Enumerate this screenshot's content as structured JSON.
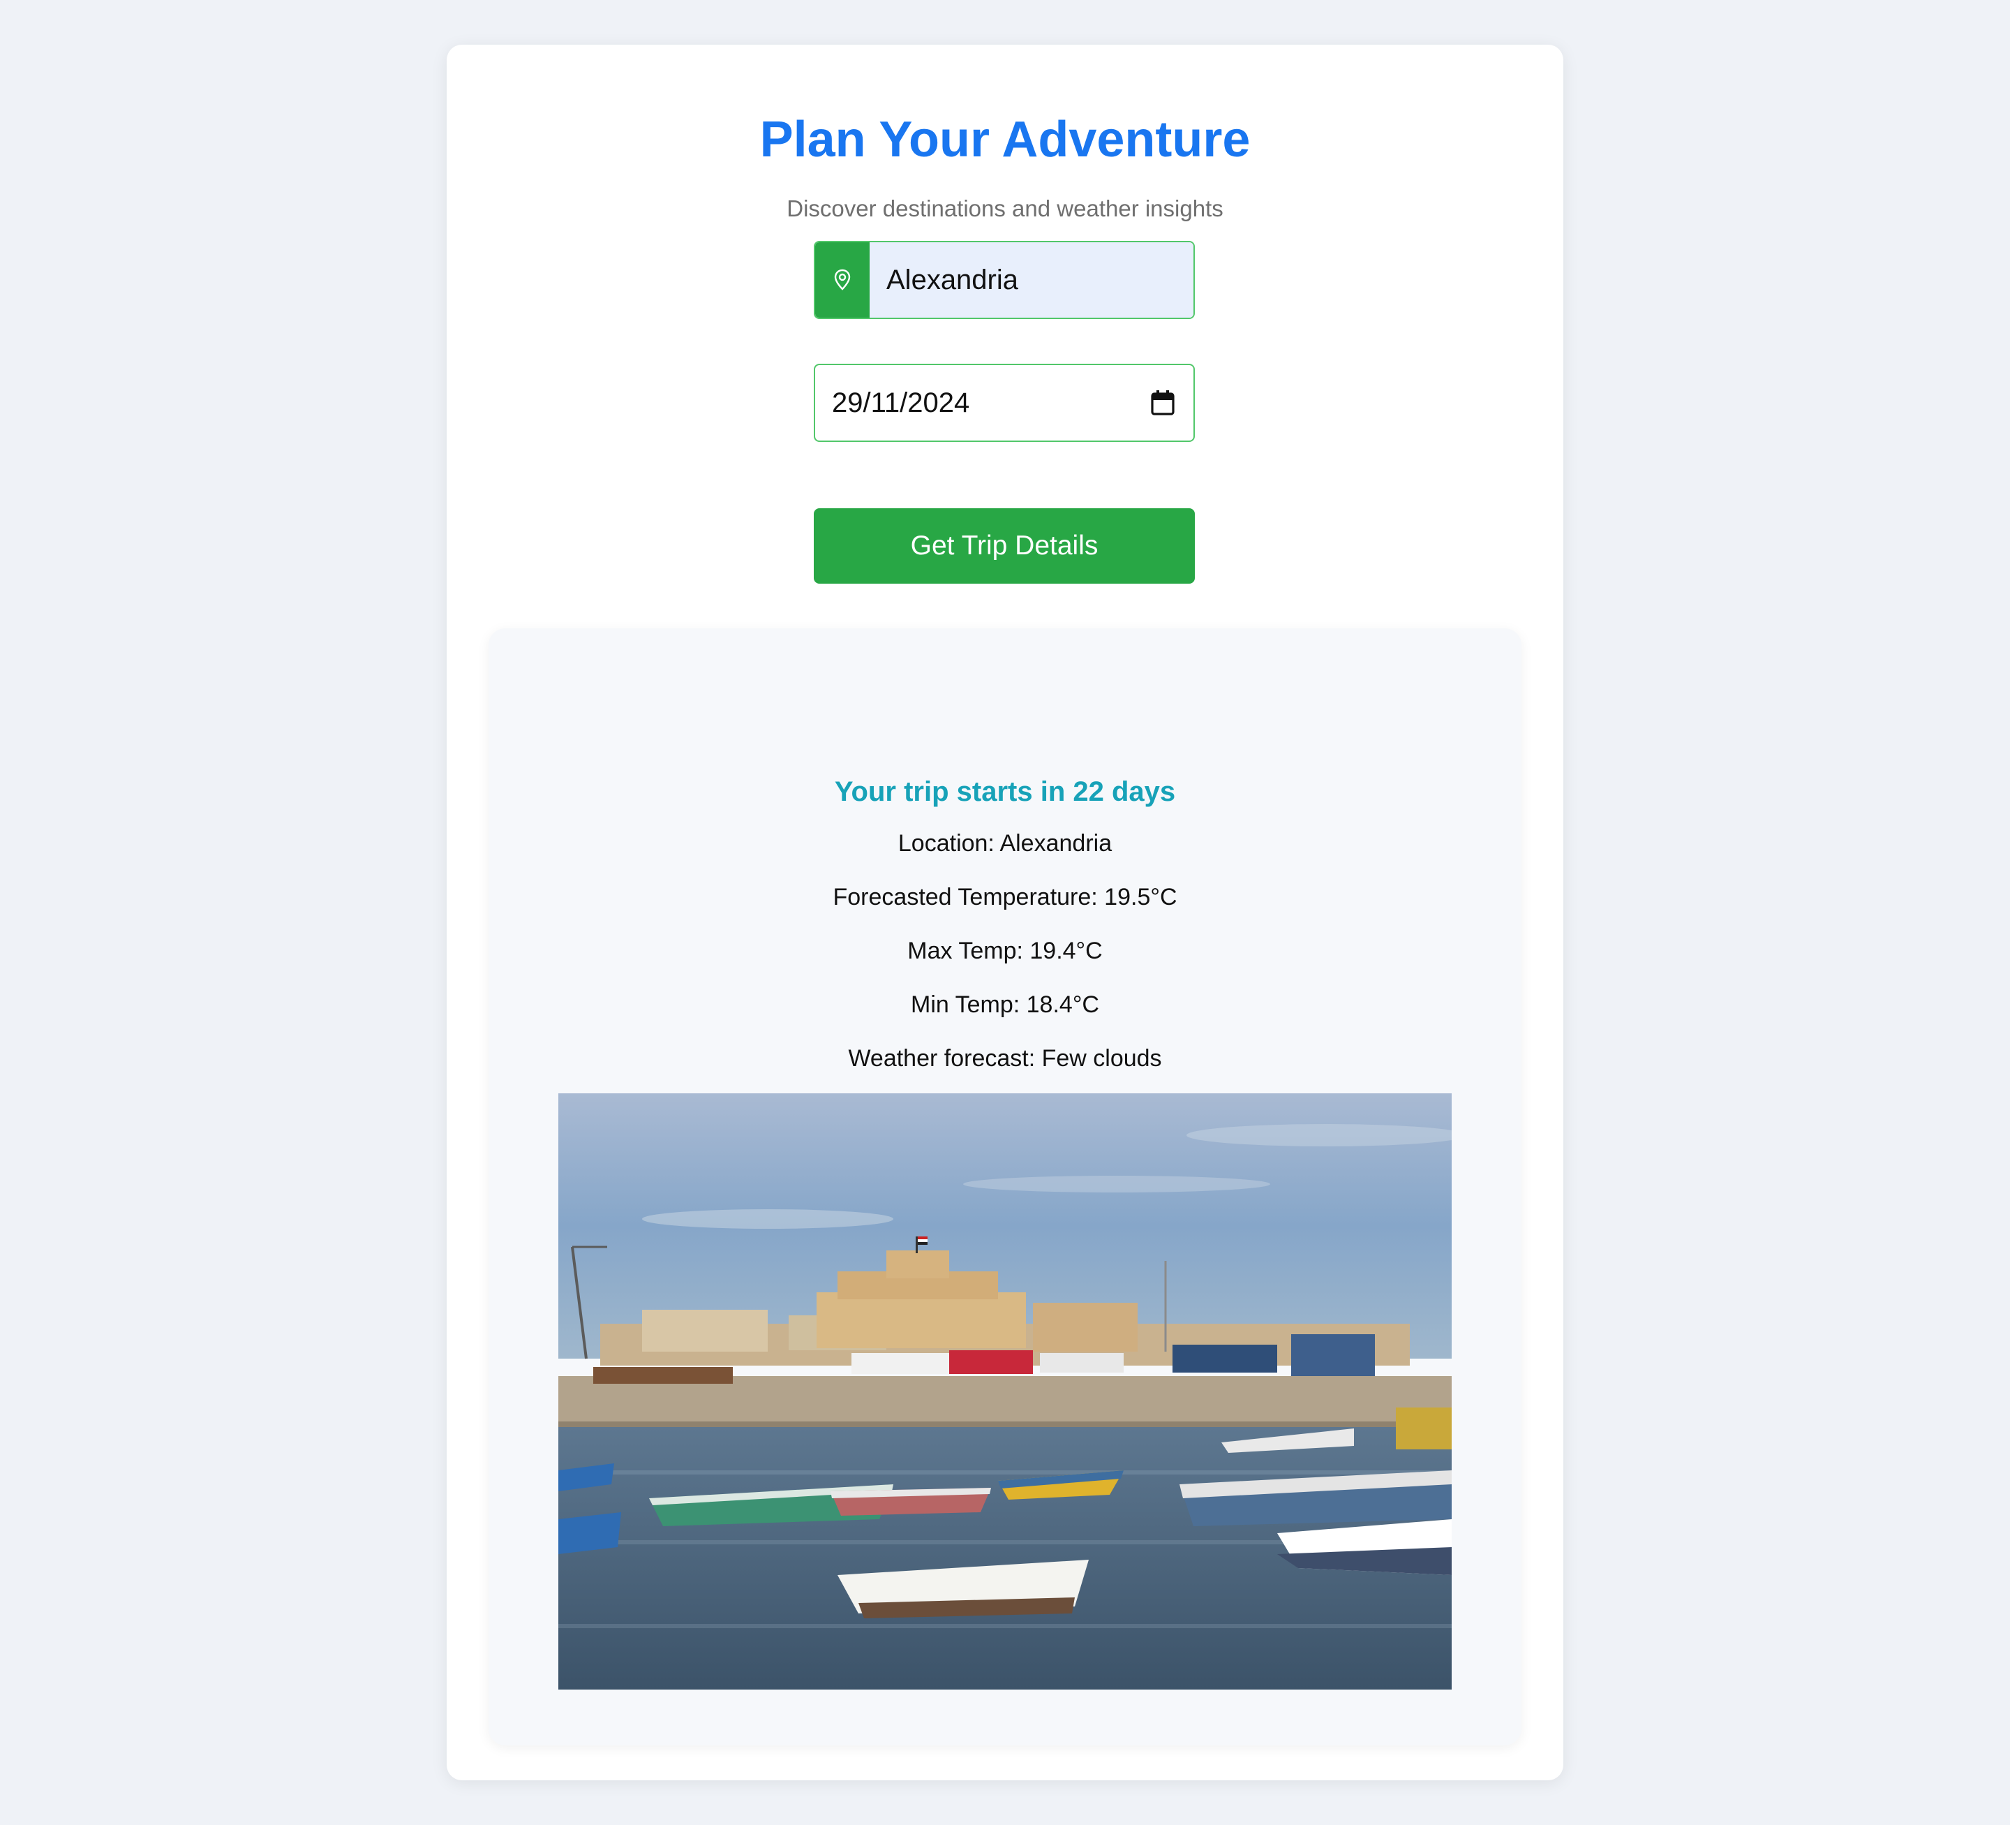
{
  "header": {
    "title": "Plan Your Adventure",
    "subtitle": "Discover destinations and weather insights"
  },
  "form": {
    "location_value": "Alexandria",
    "location_icon": "map-pin-icon",
    "date_value": "29/11/2024",
    "date_icon": "calendar-icon",
    "submit_label": "Get Trip Details"
  },
  "result": {
    "countdown": "Your trip starts in 22 days",
    "location": "Location: Alexandria",
    "forecast_temp": "Forecasted Temperature: 19.5°C",
    "max_temp": "Max Temp: 19.4°C",
    "min_temp": "Min Temp: 18.4°C",
    "weather": "Weather forecast: Few clouds"
  },
  "colors": {
    "accent_blue": "#1976f0",
    "accent_green": "#28a745",
    "countdown_teal": "#17a2b8",
    "page_background": "#eff2f7"
  }
}
